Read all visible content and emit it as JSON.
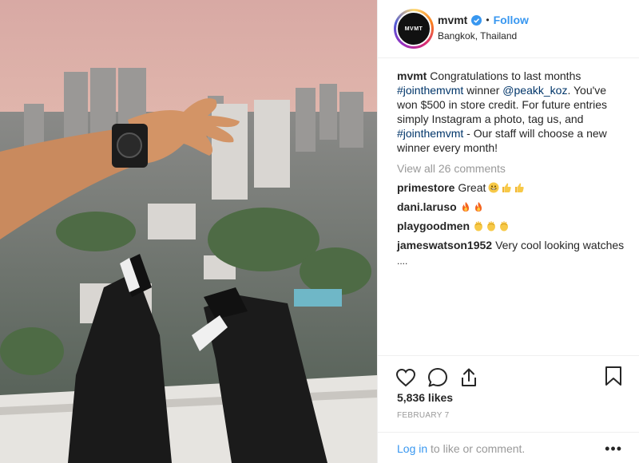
{
  "post": {
    "username": "mvmt",
    "avatar_text": "MVMT",
    "verified": true,
    "separator": "•",
    "follow_label": "Follow",
    "location": "Bangkok, Thailand"
  },
  "caption": {
    "author": "mvmt",
    "text_1": " Congratulations to last months ",
    "hashtag_1": "#jointhemvmt",
    "text_2": " winner ",
    "mention": "@peakk_koz",
    "text_3": ". You've won $500 in store credit. For future entries simply Instagram a photo, tag us, and ",
    "hashtag_2": "#jointhemvmt",
    "text_4": " - Our staff will choose a new winner every month!"
  },
  "view_all_comments": "View all 26 comments",
  "comments": [
    {
      "user": "primestore",
      "text": "Great",
      "emojis": [
        "grin-icon",
        "thumbs-up-icon",
        "thumbs-up-icon"
      ]
    },
    {
      "user": "dani.laruso",
      "text": "",
      "emojis": [
        "fire-icon",
        "fire-icon"
      ]
    },
    {
      "user": "playgoodmen",
      "text": "",
      "emojis": [
        "clap-icon",
        "clap-icon",
        "clap-icon"
      ]
    },
    {
      "user": "jameswatson1952",
      "text": "Very cool looking watches",
      "continuation": "...."
    }
  ],
  "stats": {
    "likes": "5,836 likes",
    "date": "FEBRUARY 7"
  },
  "footer": {
    "login_link": "Log in",
    "login_text": " to like or comment.",
    "more_label": "•••"
  },
  "colors": {
    "link_blue": "#3897f0",
    "caption_link": "#003569",
    "muted": "#999999",
    "text": "#262626"
  }
}
